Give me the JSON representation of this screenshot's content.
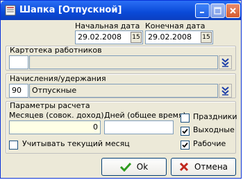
{
  "window": {
    "title": "Шапка [Отпускной]"
  },
  "dates": {
    "start_label": "Начальная дата",
    "end_label": "Конечная дата",
    "start_value": "29.02.2008",
    "end_value": "29.02.2008",
    "calendar_btn": "15"
  },
  "employees": {
    "label": "Картотека работников",
    "code": "",
    "name": ""
  },
  "accruals": {
    "label": "Начисления/удержания",
    "code": "90",
    "name": "Отпускные"
  },
  "params": {
    "label": "Параметры расчета",
    "months_label": "Месяцев (совок. доход)",
    "months_value": "0",
    "days_label": "Дней (общее время)",
    "days_value": "",
    "holidays_label": "Праздники",
    "holidays_checked": false,
    "weekends_label": "Выходные",
    "weekends_checked": true,
    "workdays_label": "Рабочие",
    "workdays_checked": true,
    "current_month_label": "Учитывать текущий месяц",
    "current_month_checked": false
  },
  "buttons": {
    "ok": "Ok",
    "cancel": "Отмена"
  },
  "colors": {
    "titlebar": "#0a4ad8",
    "ok_check": "#2e9a1e",
    "cancel_x": "#c0281e",
    "dropdown_arrow": "#1e3fa8"
  }
}
